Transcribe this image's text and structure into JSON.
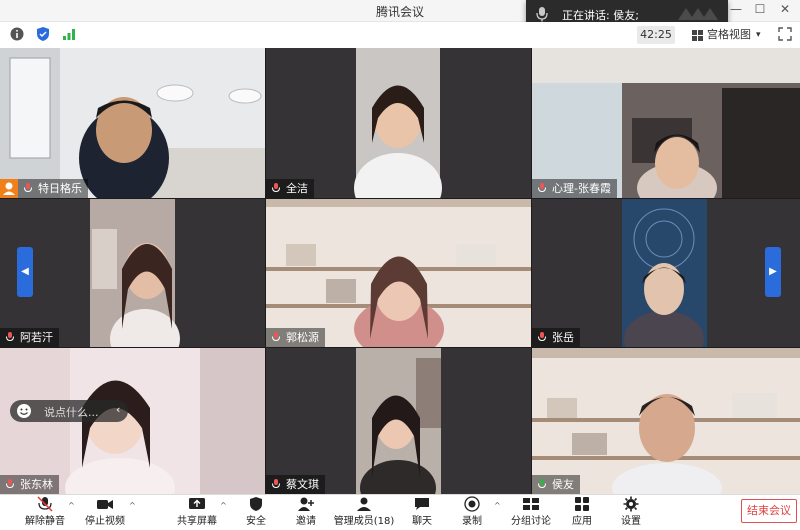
{
  "window": {
    "title": "腾讯会议"
  },
  "speaking": {
    "label": "正在讲话: 侯友;"
  },
  "topbar": {
    "timer": "42:25",
    "view_label": "宫格视图",
    "view_caret": "▾"
  },
  "participants": [
    {
      "name": "特日格乐"
    },
    {
      "name": "全洁"
    },
    {
      "name": "心理-张春霞"
    },
    {
      "name": "阿若汗"
    },
    {
      "name": "郭松源"
    },
    {
      "name": "张岳"
    },
    {
      "name": "张东林"
    },
    {
      "name": "蔡文琪"
    },
    {
      "name": "侯友"
    }
  ],
  "chat": {
    "placeholder": "说点什么...",
    "close": "‹"
  },
  "toolbar": {
    "unmute": "解除静音",
    "stop_video": "停止视频",
    "share_screen": "共享屏幕",
    "security": "安全",
    "invite": "邀请",
    "manage_members": "管理成员(18)",
    "chat": "聊天",
    "record": "录制",
    "breakout": "分组讨论",
    "apps": "应用",
    "settings": "设置",
    "end_meeting": "结束会议",
    "caret": "^"
  },
  "nav": {
    "left": "◀",
    "right": "▶"
  },
  "window_controls": {
    "minimize": "—",
    "maximize": "☐",
    "close": "✕"
  },
  "colors": {
    "accent": "#2a6cdc",
    "end": "#e04040",
    "host_badge": "#f0801a"
  }
}
